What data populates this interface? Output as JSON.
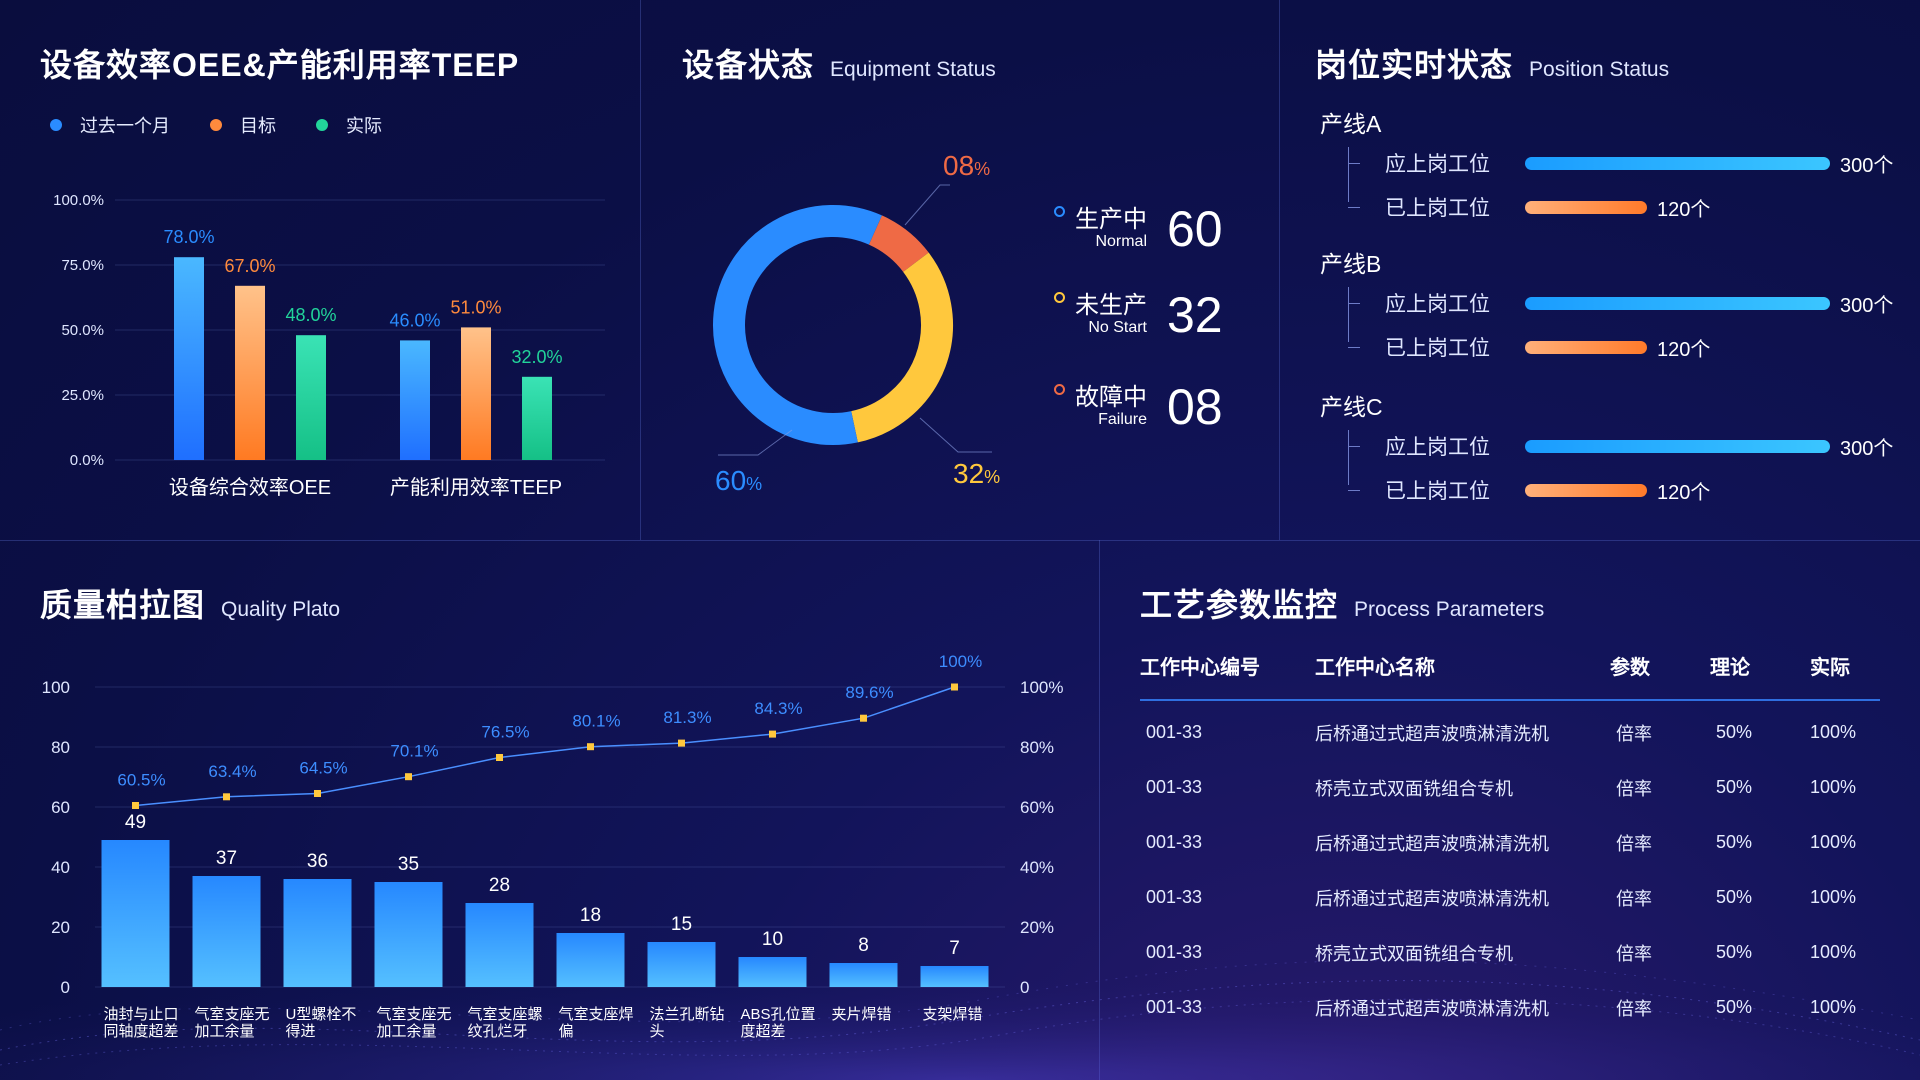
{
  "panels": {
    "oee": {
      "title_cn": "设备效率OEE&产能利用率TEEP",
      "title_en": ""
    },
    "status": {
      "title_cn": "设备状态",
      "title_en": "Equipment Status"
    },
    "position": {
      "title_cn": "岗位实时状态",
      "title_en": "Position Status"
    },
    "quality": {
      "title_cn": "质量柏拉图",
      "title_en": "Quality Plato"
    },
    "process": {
      "title_cn": "工艺参数监控",
      "title_en": "Process Parameters"
    }
  },
  "colors": {
    "blue": "#2a8cff",
    "orange": "#ff8a3d",
    "green": "#22d49a",
    "yellow": "#ffc83d",
    "red": "#ef6a45",
    "accent": "#2f6fe0"
  },
  "status_items": [
    {
      "cn": "生产中",
      "en": "Normal",
      "num": "60",
      "color": "#2a8cff"
    },
    {
      "cn": "未生产",
      "en": "No Start",
      "num": "32",
      "color": "#ffc83d"
    },
    {
      "cn": "故障中",
      "en": "Failure",
      "num": "08",
      "color": "#ef6a45"
    }
  ],
  "position_lines": [
    {
      "name": "产线A",
      "rows": [
        {
          "label": "应上岗工位",
          "value": "300个"
        },
        {
          "label": "已上岗工位",
          "value": "120个"
        }
      ]
    },
    {
      "name": "产线B",
      "rows": [
        {
          "label": "应上岗工位",
          "value": "300个"
        },
        {
          "label": "已上岗工位",
          "value": "120个"
        }
      ]
    },
    {
      "name": "产线C",
      "rows": [
        {
          "label": "应上岗工位",
          "value": "300个"
        },
        {
          "label": "已上岗工位",
          "value": "120个"
        }
      ]
    }
  ],
  "process_table": {
    "headers": [
      "工作中心编号",
      "工作中心名称",
      "参数",
      "理论",
      "实际"
    ],
    "rows": [
      [
        "001-33",
        "后桥通过式超声波喷淋清洗机",
        "倍率",
        "50%",
        "100%"
      ],
      [
        "001-33",
        "桥壳立式双面铣组合专机",
        "倍率",
        "50%",
        "100%"
      ],
      [
        "001-33",
        "后桥通过式超声波喷淋清洗机",
        "倍率",
        "50%",
        "100%"
      ],
      [
        "001-33",
        "后桥通过式超声波喷淋清洗机",
        "倍率",
        "50%",
        "100%"
      ],
      [
        "001-33",
        "桥壳立式双面铣组合专机",
        "倍率",
        "50%",
        "100%"
      ],
      [
        "001-33",
        "后桥通过式超声波喷淋清洗机",
        "倍率",
        "50%",
        "100%"
      ]
    ]
  },
  "chart_data": [
    {
      "type": "bar",
      "title": "设备效率OEE&产能利用率TEEP",
      "categories": [
        "设备综合效率OEE",
        "产能利用效率TEEP"
      ],
      "series": [
        {
          "name": "过去一个月",
          "values": [
            78.0,
            46.0
          ],
          "labels": [
            "78.0%",
            "46.0%"
          ],
          "color": "#2a8cff"
        },
        {
          "name": "目标",
          "values": [
            67.0,
            51.0
          ],
          "labels": [
            "67.0%",
            "51.0%"
          ],
          "color": "#ff8a3d"
        },
        {
          "name": "实际",
          "values": [
            48.0,
            32.0
          ],
          "labels": [
            "48.0%",
            "32.0%"
          ],
          "color": "#22d49a"
        }
      ],
      "yticks": [
        "100.0%",
        "75.0%",
        "50.0%",
        "25.0%",
        "0.0%"
      ],
      "ylim": [
        0,
        100
      ],
      "grid": true,
      "legend": "top-left"
    },
    {
      "type": "pie",
      "title": "设备状态",
      "slices": [
        {
          "label": "60%",
          "value": 60,
          "color": "#2a8cff"
        },
        {
          "label": "32%",
          "value": 32,
          "color": "#ffc83d"
        },
        {
          "label": "08%",
          "value": 8,
          "color": "#ef6a45"
        }
      ]
    },
    {
      "type": "bar",
      "title": "岗位实时状态",
      "categories": [
        "应上岗工位",
        "已上岗工位"
      ],
      "groups": [
        "产线A",
        "产线B",
        "产线C"
      ],
      "values": [
        [
          300,
          120
        ],
        [
          300,
          120
        ],
        [
          300,
          120
        ]
      ],
      "xlim": [
        0,
        300
      ]
    },
    {
      "type": "bar",
      "title": "质量柏拉图",
      "categories": [
        "油封与止口同轴度超差",
        "气室支座无加工余量",
        "U型螺栓不得进",
        "气室支座无加工余量",
        "气室支座螺纹孔烂牙",
        "气室支座焊偏",
        "法兰孔断钻头",
        "ABS孔位置度超差",
        "夹片焊错",
        "支架焊错"
      ],
      "category_lines": [
        [
          "油封与止口",
          "同轴度超差"
        ],
        [
          "气室支座无",
          "加工余量"
        ],
        [
          "U型螺栓不",
          "得进"
        ],
        [
          "气室支座无",
          "加工余量"
        ],
        [
          "气室支座螺",
          "纹孔烂牙"
        ],
        [
          "气室支座焊",
          "偏"
        ],
        [
          "法兰孔断钻",
          "头"
        ],
        [
          "ABS孔位置",
          "度超差"
        ],
        [
          "夹片焊错"
        ],
        [
          "支架焊错"
        ]
      ],
      "values": [
        49,
        37,
        36,
        35,
        28,
        18,
        15,
        10,
        8,
        7
      ],
      "cumulative": [
        60.5,
        63.4,
        64.5,
        70.1,
        76.5,
        80.1,
        81.3,
        84.3,
        89.6,
        100
      ],
      "cumulative_labels": [
        "60.5%",
        "63.4%",
        "64.5%",
        "70.1%",
        "76.5%",
        "80.1%",
        "81.3%",
        "84.3%",
        "89.6%",
        "100%"
      ],
      "y_left_ticks": [
        "100",
        "80",
        "60",
        "40",
        "20",
        "0"
      ],
      "y_right_ticks": [
        "100%",
        "80%",
        "60%",
        "40%",
        "20%",
        "0"
      ],
      "ylim": [
        0,
        100
      ],
      "ylim_right": [
        0,
        100
      ],
      "grid": true
    }
  ]
}
